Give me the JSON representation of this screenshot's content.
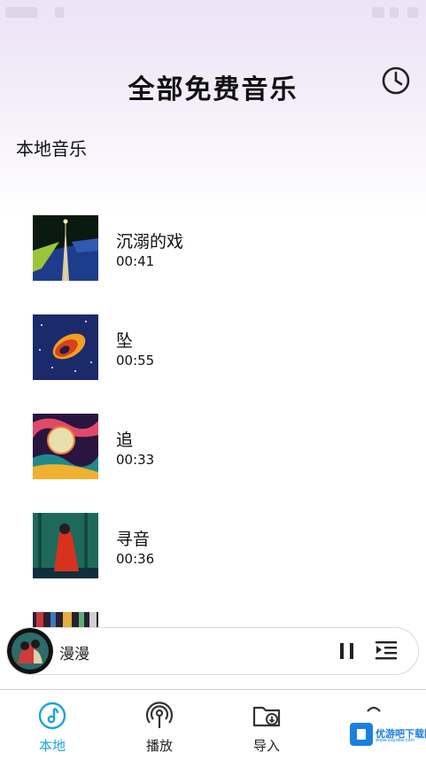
{
  "header": {
    "title": "全部免费音乐",
    "history_icon": "clock-icon"
  },
  "section": {
    "title": "本地音乐"
  },
  "songs": [
    {
      "title": "沉溺的戏",
      "duration": "00:41",
      "cover": "album-cover-road"
    },
    {
      "title": "坠",
      "duration": "00:55",
      "cover": "album-cover-comet"
    },
    {
      "title": "追",
      "duration": "00:33",
      "cover": "album-cover-moon"
    },
    {
      "title": "寻音",
      "duration": "00:36",
      "cover": "album-cover-couple"
    },
    {
      "title": "",
      "duration": "",
      "cover": "album-cover-city"
    }
  ],
  "player": {
    "title": "漫漫",
    "state": "playing"
  },
  "nav": [
    {
      "label": "本地",
      "icon": "music-note-icon",
      "active": true
    },
    {
      "label": "播放",
      "icon": "broadcast-icon",
      "active": false
    },
    {
      "label": "导入",
      "icon": "folder-import-icon",
      "active": false
    },
    {
      "label": "",
      "icon": "more-icon",
      "active": false
    }
  ],
  "watermark": {
    "text": "优游吧下载网",
    "url": "www.uuyoba.com"
  },
  "colors": {
    "accent": "#1ba3dd",
    "background_top": "#ece3f7",
    "text": "#111111"
  }
}
